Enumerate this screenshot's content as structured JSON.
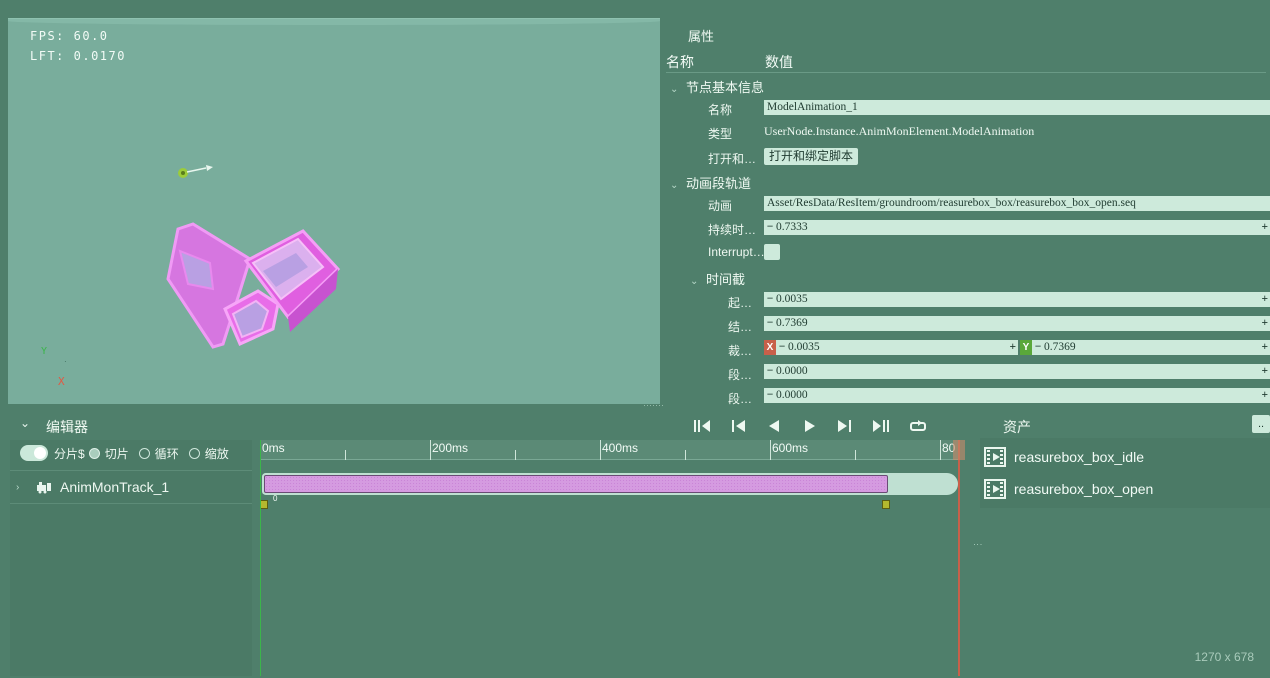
{
  "viewport": {
    "fps": "FPS: 60.0",
    "lft": "LFT: 0.0170",
    "axis_y": "Y",
    "axis_x": "X"
  },
  "properties": {
    "title": "属性",
    "col_name": "名称",
    "col_value": "数值",
    "section_basic": "节点基本信息",
    "name_label": "名称",
    "name_value": "ModelAnimation_1",
    "type_label": "类型",
    "type_value": "UserNode.Instance.AnimMonElement.ModelAnimation",
    "open_label": "打开和…",
    "open_button": "打开和绑定脚本",
    "section_track": "动画段轨道",
    "anim_label": "动画",
    "anim_value": "Asset/ResData/ResItem/groundroom/reasurebox_box/reasurebox_box_open.seq",
    "duration_label": "持续时…",
    "duration_value": "0.7333",
    "interrupt_label": "Interrupt…",
    "section_clip": "时间截",
    "start_label": "起…",
    "start_value": "0.0035",
    "end_label": "结…",
    "end_value": "0.7369",
    "crop_label": "裁…",
    "crop_x_tag": "X",
    "crop_x": "0.0035",
    "crop_y_tag": "Y",
    "crop_y": "0.7369",
    "seg1_label": "段…",
    "seg1_value": "0.0000",
    "seg2_label": "段…",
    "seg2_value": "0.0000"
  },
  "editor": {
    "title": "编辑器",
    "opt_split": "分片$",
    "opt_slice": "切片",
    "opt_loop": "循环",
    "opt_scale": "缩放",
    "track_name": "AnimMonTrack_1"
  },
  "timeline": {
    "ticks": [
      "0ms",
      "200ms",
      "400ms",
      "600ms",
      "80"
    ],
    "clip_start_label": "0"
  },
  "assets": {
    "title": "资产",
    "more_button": "..",
    "items": [
      {
        "label": "reasurebox_box_idle"
      },
      {
        "label": "reasurebox_box_open"
      }
    ]
  },
  "footer": {
    "size": "1270 x 678"
  },
  "colors": {
    "background": "#4f7f6b",
    "viewport": "#79ad9c",
    "field": "#cdeadb",
    "clip": "#d59be0",
    "model": "#e060e0",
    "playhead": "#c8604a",
    "x_axis": "#e05a44",
    "y_axis": "#3bb54a"
  }
}
